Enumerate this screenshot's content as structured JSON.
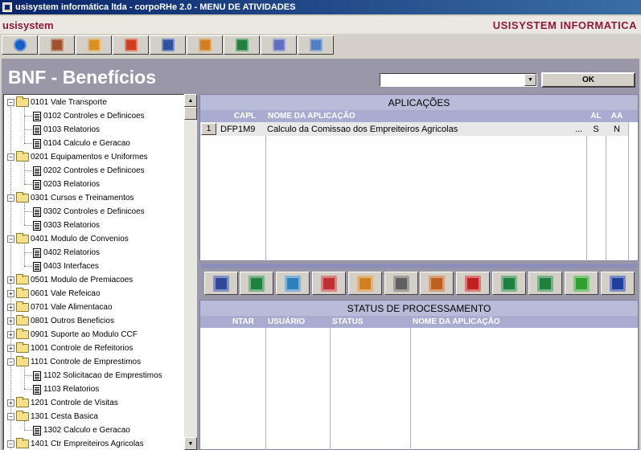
{
  "window": {
    "title": "usisystem informática ltda - corpoRHe 2.0 - MENU DE ATIVIDADES"
  },
  "brand": {
    "left": "usisystem",
    "right": "USISYSTEM INFORMATICA"
  },
  "toolbar": {
    "buttons": [
      {
        "icon": "back-icon",
        "color": "#1a5fc8"
      },
      {
        "icon": "users-icon",
        "color": "#a0522d"
      },
      {
        "icon": "hand-icon",
        "color": "#d89020"
      },
      {
        "icon": "document-delete-icon",
        "color": "#d04020"
      },
      {
        "icon": "checklist-icon",
        "color": "#3050a0"
      },
      {
        "icon": "book-icon",
        "color": "#d08020"
      },
      {
        "icon": "green-book-icon",
        "color": "#208040"
      },
      {
        "icon": "settings-panel-icon",
        "color": "#6070c0"
      },
      {
        "icon": "grid-panel-icon",
        "color": "#5080c0"
      }
    ]
  },
  "page": {
    "title": "BNF - Benefícios",
    "ok_label": "OK",
    "select_value": ""
  },
  "tree": {
    "items": [
      {
        "label": "0101 Vale Transporte",
        "type": "folder",
        "expanded": true
      },
      {
        "label": "0102 Controles e Definicoes",
        "type": "doc"
      },
      {
        "label": "0103 Relatorios",
        "type": "doc"
      },
      {
        "label": "0104 Calculo e Geracao",
        "type": "doc"
      },
      {
        "label": "0201 Equipamentos e Uniformes",
        "type": "folder",
        "expanded": true
      },
      {
        "label": "0202 Controles e Definicoes",
        "type": "doc"
      },
      {
        "label": "0203 Relatorios",
        "type": "doc"
      },
      {
        "label": "0301 Cursos e Treinamentos",
        "type": "folder",
        "expanded": true
      },
      {
        "label": "0302 Controles e Definicoes",
        "type": "doc"
      },
      {
        "label": "0303 Relatorios",
        "type": "doc"
      },
      {
        "label": "0401 Modulo de Convenios",
        "type": "folder",
        "expanded": true
      },
      {
        "label": "0402 Relatorios",
        "type": "doc"
      },
      {
        "label": "0403 Interfaces",
        "type": "doc"
      },
      {
        "label": "0501 Modulo de Premiacoes",
        "type": "folder",
        "expanded": false
      },
      {
        "label": "0601 Vale Refeicao",
        "type": "folder",
        "expanded": false
      },
      {
        "label": "0701 Vale Alimentacao",
        "type": "folder",
        "expanded": false
      },
      {
        "label": "0801 Outros Beneficios",
        "type": "folder",
        "expanded": false
      },
      {
        "label": "0901 Suporte ao Modulo CCF",
        "type": "folder",
        "expanded": false
      },
      {
        "label": "1001 Controle de Refeitorios",
        "type": "folder",
        "expanded": false
      },
      {
        "label": "1101 Controle de Emprestimos",
        "type": "folder",
        "expanded": true
      },
      {
        "label": "1102 Solicitacao de Emprestimos",
        "type": "doc"
      },
      {
        "label": "1103 Relatorios",
        "type": "doc"
      },
      {
        "label": "1201 Controle de Visitas",
        "type": "folder",
        "expanded": false
      },
      {
        "label": "1301 Cesta Basica",
        "type": "folder",
        "expanded": true
      },
      {
        "label": "1302 Calculo e Geracao",
        "type": "doc"
      },
      {
        "label": "1401 Ctr Empreiteiros Agricolas",
        "type": "folder",
        "expanded": true
      }
    ]
  },
  "applications": {
    "title": "APLICAÇÕES",
    "columns": [
      "CAPL",
      "NOME DA APLICAÇÃO",
      "AL",
      "AA"
    ],
    "rows": [
      {
        "num": "1",
        "capl": "DFP1M9",
        "name": "Calculo da Comissao dos Empreiteiros Agricolas",
        "ellipsis": "...",
        "al": "S",
        "aa": "N"
      }
    ]
  },
  "actions": {
    "buttons": [
      {
        "icon": "tree-list-icon",
        "color": "#304898"
      },
      {
        "icon": "tree-add-icon",
        "color": "#208040"
      },
      {
        "icon": "refresh-icon",
        "color": "#3080c0"
      },
      {
        "icon": "chart-panel-icon",
        "color": "#c03030"
      },
      {
        "icon": "clock-icon",
        "color": "#d08020"
      },
      {
        "icon": "printer-icon",
        "color": "#606060"
      },
      {
        "icon": "upload-doc-icon",
        "color": "#c06020"
      },
      {
        "icon": "red-book-icon",
        "color": "#c02020"
      },
      {
        "icon": "export-doc-icon",
        "color": "#208040"
      },
      {
        "icon": "import-doc-icon",
        "color": "#208040"
      },
      {
        "icon": "green-arrow-book-icon",
        "color": "#30a030"
      },
      {
        "icon": "word-doc-icon",
        "color": "#2040a0"
      }
    ]
  },
  "status": {
    "title": "STATUS DE PROCESSAMENTO",
    "columns": [
      "NTAR",
      "USUÁRIO",
      "STATUS",
      "NOME DA APLICAÇÃO"
    ]
  }
}
